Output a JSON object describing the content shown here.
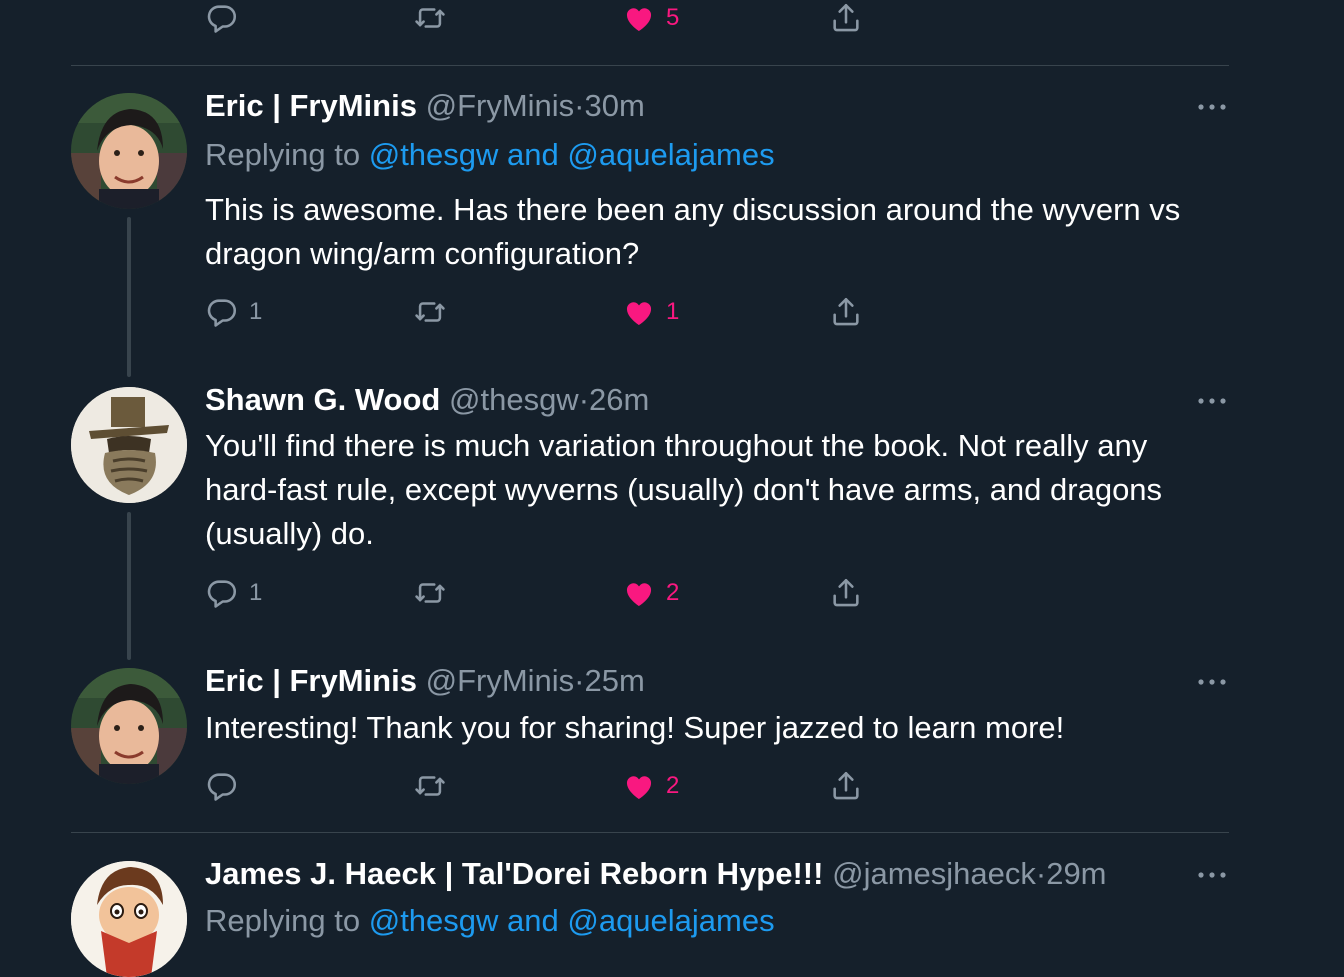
{
  "top_actions": {
    "reply_count": "",
    "retweet_count": "",
    "like_count": "5"
  },
  "tweets": [
    {
      "name": "Eric | FryMinis",
      "handle": "@FryMinis",
      "dot": "·",
      "time": "30m",
      "replying_prefix": "Replying to",
      "replying_users": "@thesgw and @aquelajames",
      "text": "This is awesome. Has there been any discussion around the wyvern vs dragon wing/arm configuration?",
      "reply_count": "1",
      "retweet_count": "",
      "like_count": "1"
    },
    {
      "name": "Shawn G. Wood",
      "handle": "@thesgw",
      "dot": "·",
      "time": "26m",
      "text": "You'll find there is much variation throughout the book. Not really any hard-fast rule, except wyverns (usually) don't have arms, and dragons (usually) do.",
      "reply_count": "1",
      "retweet_count": "",
      "like_count": "2"
    },
    {
      "name": "Eric | FryMinis",
      "handle": "@FryMinis",
      "dot": "·",
      "time": "25m",
      "text": "Interesting! Thank you for sharing! Super jazzed to learn more!",
      "reply_count": "",
      "retweet_count": "",
      "like_count": "2"
    },
    {
      "name": "James J. Haeck | Tal'Dorei Reborn Hype!!!",
      "handle": "@jamesjhaeck",
      "dot": "·",
      "time": "29m",
      "replying_prefix": "Replying to",
      "replying_users": "@thesgw and @aquelajames"
    }
  ],
  "colors": {
    "background": "#15202b",
    "divider": "#38444d",
    "muted_text": "#8b98a5",
    "link": "#1d9bf0",
    "liked": "#f91880"
  },
  "icons": [
    "reply-icon",
    "retweet-icon",
    "heart-filled-icon",
    "share-icon",
    "more-icon"
  ]
}
